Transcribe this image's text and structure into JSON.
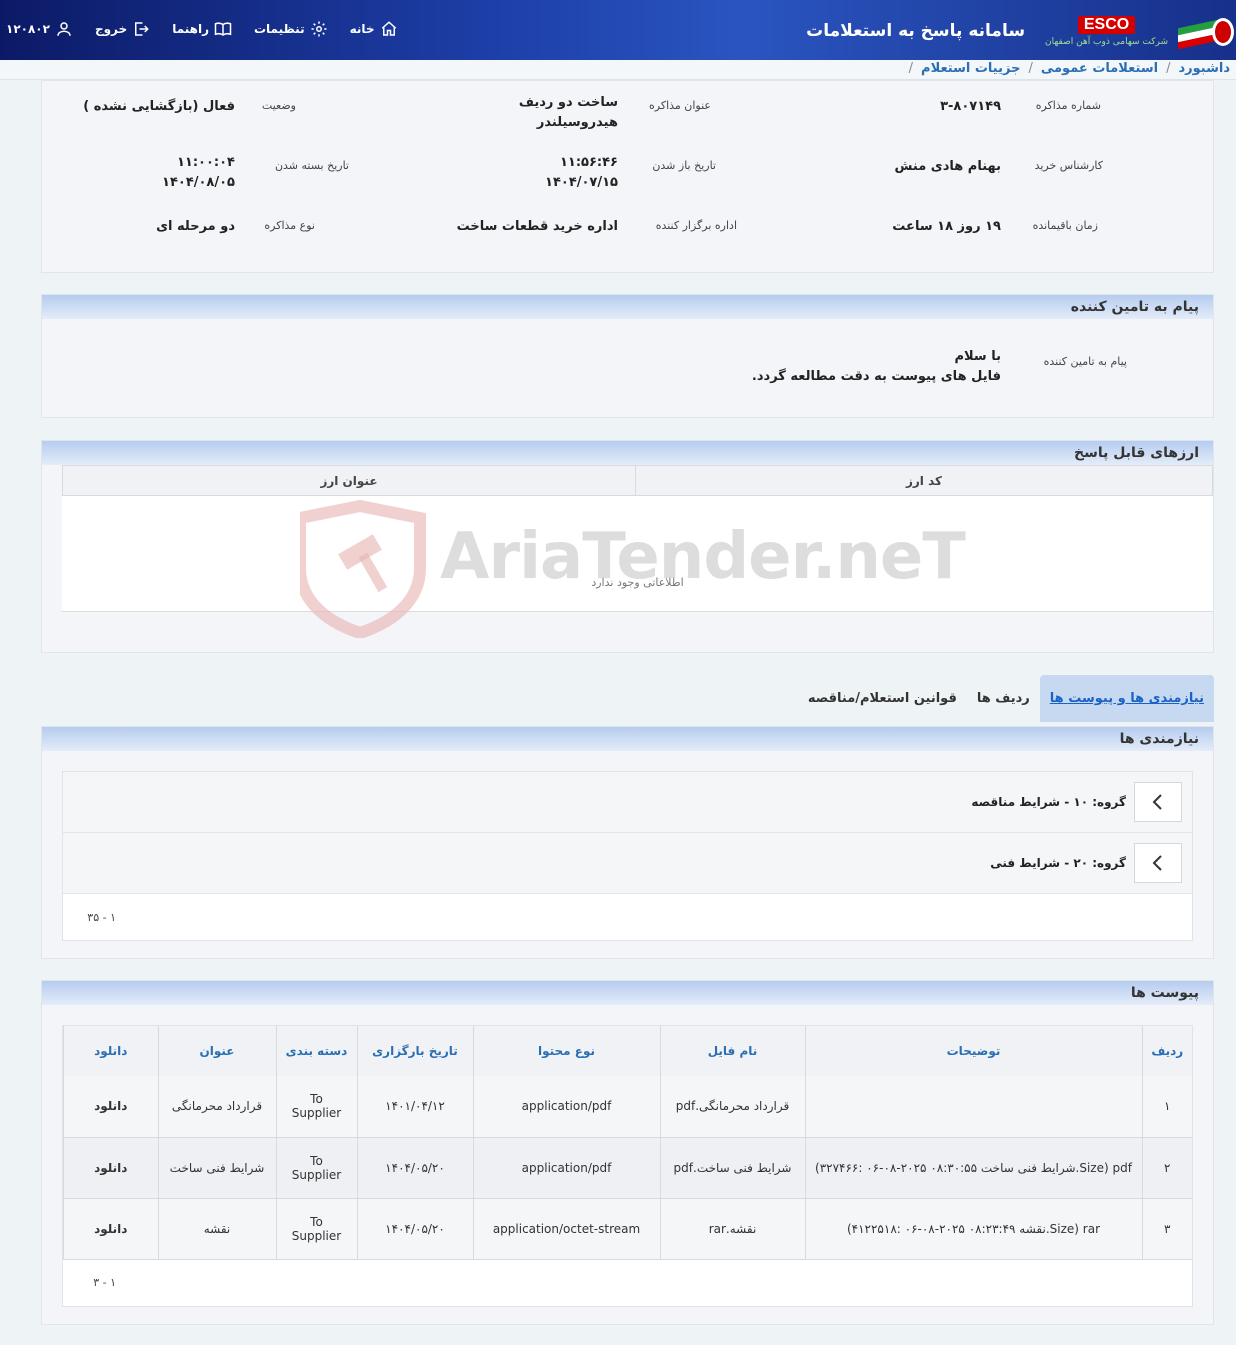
{
  "header": {
    "system_title": "سامانه پاسخ به استعلامات",
    "esco_label": "ESCO",
    "esco_subtitle": "شرکت سهامی ذوب آهن اصفهان",
    "menu": {
      "home": "خانه",
      "settings": "تنظیمات",
      "guide": "راهنما",
      "logout": "خروج",
      "user_id": "۱۲۰۸۰۲"
    }
  },
  "breadcrumb": [
    "داشبورد",
    "استعلامات عمومی",
    "جزییات استعلام"
  ],
  "info": {
    "negotiation_number_label": "شماره مذاکره",
    "negotiation_number": "۳-۸۰۷۱۴۹",
    "title_label": "عنوان مذاکره",
    "title": "ساخت دو ردیف هیدروسیلندر",
    "status_label": "وضعیت",
    "status": "فعال (بازگشایی نشده )",
    "expert_label": "کارشناس خرید",
    "expert": "بهنام هادی منش",
    "open_date_label": "تاریخ باز شدن",
    "open_time": "۱۱:۵۶:۴۶",
    "open_date": "۱۴۰۴/۰۷/۱۵",
    "close_date_label": "تاریخ بسته شدن",
    "close_time": "۱۱:۰۰:۰۴",
    "close_date": "۱۴۰۴/۰۸/۰۵",
    "remaining_label": "زمان باقیمانده",
    "remaining": "۱۹ روز ۱۸ ساعت",
    "organizer_label": "اداره برگزار کننده",
    "organizer": "اداره خرید قطعات ساخت",
    "type_label": "نوع مذاکره",
    "type": "دو مرحله ای"
  },
  "supplier_message": {
    "section_title": "پیام به تامین کننده",
    "label": "پیام به تامین کننده",
    "line1": "با سلام",
    "line2": "فایل های پیوست به دقت مطالعه گردد."
  },
  "currencies": {
    "section_title": "ارزهای قابل پاسخ",
    "col_code": "کد ارز",
    "col_title": "عنوان ارز",
    "empty": "اطلاعاتی وجود ندارد"
  },
  "watermark": "AriaTender.neT",
  "tabs": [
    "نیازمندی ها و پیوست ها",
    "ردیف ها",
    "قوانین استعلام/مناقصه"
  ],
  "requirements": {
    "section_title": "نیازمندی ها",
    "groups": [
      "گروه: ۱۰ - شرایط مناقصه",
      "گروه: ۲۰ - شرایط فنی"
    ],
    "pager": "۱ - ۳۵"
  },
  "attachments": {
    "section_title": "پیوست ها",
    "columns": [
      "ردیف",
      "توضیحات",
      "نام فایل",
      "نوع محتوا",
      "تاریخ بارگزاری",
      "دسته بندی",
      "عنوان",
      "دانلود"
    ],
    "rows": [
      {
        "n": "۱",
        "desc": "",
        "file": "قرارداد محرمانگی.pdf",
        "type": "application/pdf",
        "date": "۱۴۰۱/۰۴/۱۲",
        "cat": "To Supplier",
        "title": "قرارداد محرمانگی",
        "dl": "دانلود"
      },
      {
        "n": "۲",
        "desc": "pdf (Size.شرایط فنی ساخت ۰۸:۳۰:۵۵ ۲۰۲۵-۰۸-۰۶ :۳۲۷۴۶۶)",
        "file": "شرایط فنی ساخت.pdf",
        "type": "application/pdf",
        "date": "۱۴۰۴/۰۵/۲۰",
        "cat": "To Supplier",
        "title": "شرایط فنی ساخت",
        "dl": "دانلود"
      },
      {
        "n": "۳",
        "desc": "rar (Size.نقشه ۰۸:۲۳:۴۹ ۲۰۲۵-۰۸-۰۶ :۴۱۲۲۵۱۸)",
        "file": "نقشه.rar",
        "type": "application/octet-stream",
        "date": "۱۴۰۴/۰۵/۲۰",
        "cat": "To Supplier",
        "title": "نقشه",
        "dl": "دانلود"
      }
    ],
    "pager": "۱ - ۳"
  }
}
